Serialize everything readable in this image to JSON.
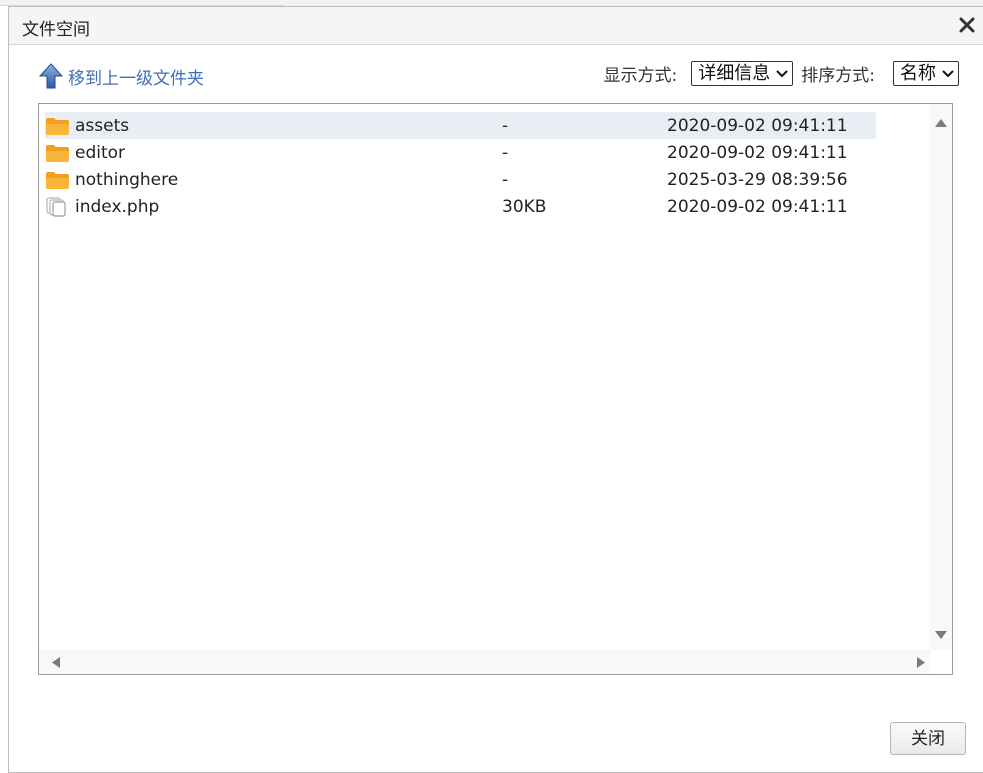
{
  "dialog": {
    "title": "文件空间",
    "close_icon": "close-icon"
  },
  "toolbar": {
    "up_label": "移到上一级文件夹",
    "up_icon": "up-arrow-icon",
    "view_label": "显示方式:",
    "view_value": "详细信息",
    "sort_label": "排序方式:",
    "sort_value": "名称"
  },
  "files": [
    {
      "name": "assets",
      "size": "-",
      "date": "2020-09-02 09:41:11",
      "icon": "folder-icon",
      "selected": true
    },
    {
      "name": "editor",
      "size": "-",
      "date": "2020-09-02 09:41:11",
      "icon": "folder-icon",
      "selected": false
    },
    {
      "name": "nothinghere",
      "size": "-",
      "date": "2025-03-29 08:39:56",
      "icon": "folder-icon",
      "selected": false
    },
    {
      "name": "index.php",
      "size": "30KB",
      "date": "2020-09-02 09:41:11",
      "icon": "file-icon",
      "selected": false
    }
  ],
  "footer": {
    "close_label": "关闭"
  },
  "colors": {
    "link": "#3f6fb8",
    "selected_row": "#e9eef5",
    "folder": "#f0a01e"
  }
}
